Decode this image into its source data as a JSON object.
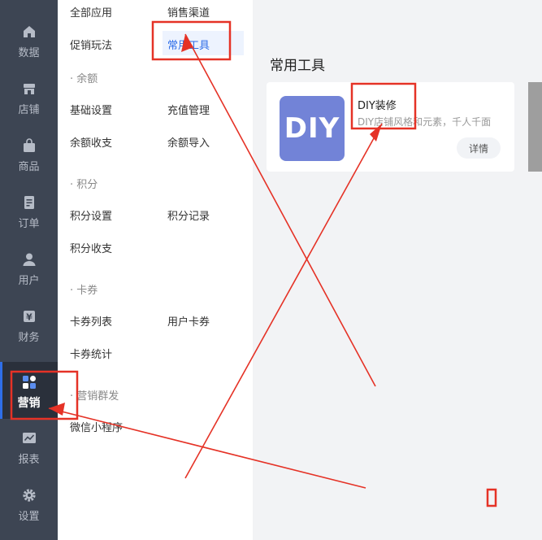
{
  "nav": [
    {
      "label": "数据",
      "icon": "home-icon"
    },
    {
      "label": "店铺",
      "icon": "store-icon"
    },
    {
      "label": "商品",
      "icon": "bag-icon"
    },
    {
      "label": "订单",
      "icon": "order-icon"
    },
    {
      "label": "用户",
      "icon": "user-icon"
    },
    {
      "label": "财务",
      "icon": "finance-icon"
    },
    {
      "label": "营销",
      "icon": "marketing-icon",
      "active": true
    },
    {
      "label": "报表",
      "icon": "report-icon"
    },
    {
      "label": "设置",
      "icon": "settings-icon"
    }
  ],
  "submenu": {
    "top_left": [
      "全部应用",
      "促销玩法"
    ],
    "top_right": [
      "销售渠道",
      "常用工具"
    ],
    "groups": [
      {
        "title": "· 余额",
        "left": [
          "基础设置",
          "余额收支"
        ],
        "right": [
          "充值管理",
          "余额导入"
        ]
      },
      {
        "title": "· 积分",
        "left": [
          "积分设置",
          "积分收支"
        ],
        "right": [
          "积分记录"
        ]
      },
      {
        "title": "· 卡券",
        "left": [
          "卡券列表",
          "卡券统计"
        ],
        "right": [
          "用户卡券"
        ]
      },
      {
        "title": "· 营销群发",
        "left": [
          "微信小程序"
        ],
        "right": []
      }
    ]
  },
  "main": {
    "title": "常用工具",
    "card": {
      "logo_text": "DIY",
      "name": "DIY装修",
      "desc": "DIY店铺风格和元素，千人千面",
      "button": "详情"
    }
  },
  "colors": {
    "nav_bg": "#3d4553",
    "nav_active": "#2a303b",
    "accent": "#2f6ee8",
    "annotation": "#e53226"
  }
}
